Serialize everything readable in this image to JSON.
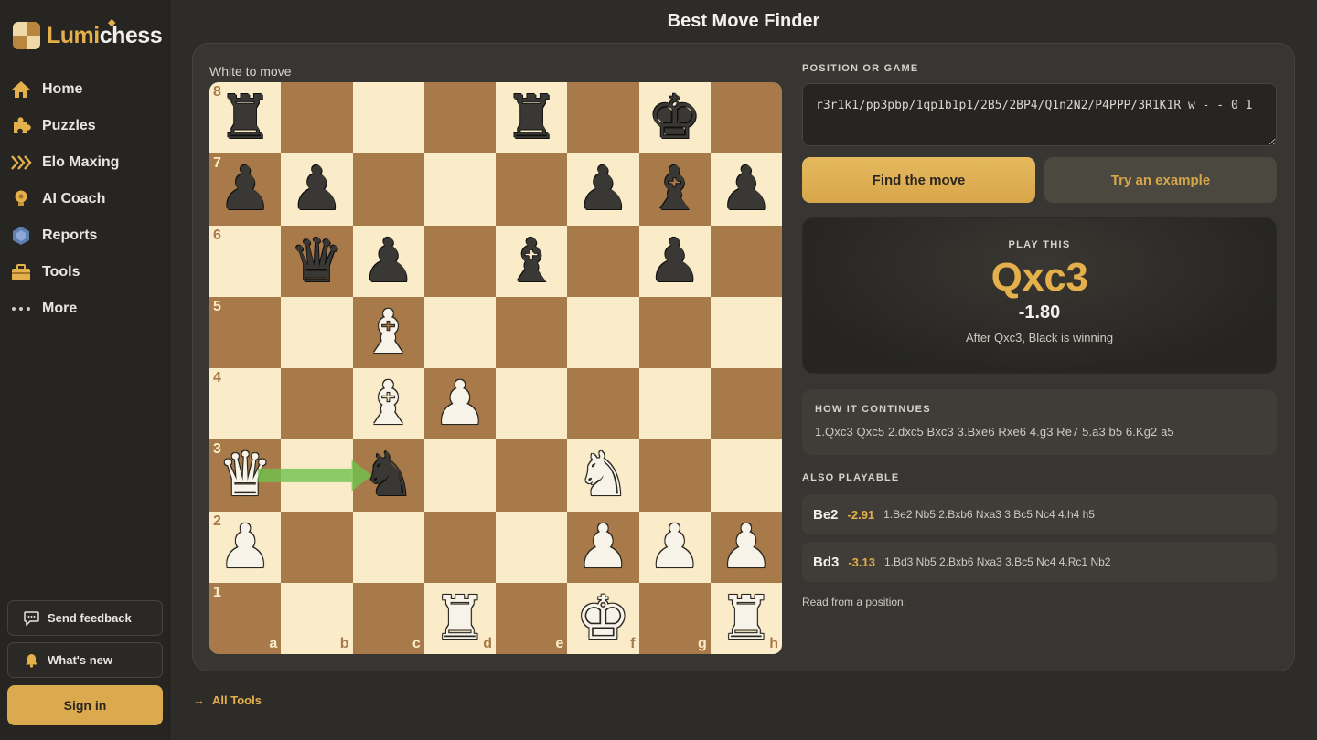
{
  "brand": {
    "part1": "Lumi",
    "part2": "chess"
  },
  "nav": [
    {
      "label": "Home",
      "icon": "home-icon"
    },
    {
      "label": "Puzzles",
      "icon": "puzzle-icon"
    },
    {
      "label": "Elo Maxing",
      "icon": "chevrons-right-icon"
    },
    {
      "label": "AI Coach",
      "icon": "lightbulb-icon"
    },
    {
      "label": "Reports",
      "icon": "hexagon-icon"
    },
    {
      "label": "Tools",
      "icon": "toolbox-icon"
    },
    {
      "label": "More",
      "icon": "more-dots-icon"
    }
  ],
  "sidebar_footer": {
    "feedback": "Send feedback",
    "whats_new": "What's new",
    "sign_in": "Sign in"
  },
  "page_title": "Best Move Finder",
  "board": {
    "to_move": "White to move",
    "ranks": [
      "8",
      "7",
      "6",
      "5",
      "4",
      "3",
      "2",
      "1"
    ],
    "files": [
      "a",
      "b",
      "c",
      "d",
      "e",
      "f",
      "g",
      "h"
    ],
    "position": [
      [
        "bR",
        "",
        "",
        "",
        "bR",
        "",
        "bK",
        ""
      ],
      [
        "bP",
        "bP",
        "",
        "",
        "",
        "bP",
        "bB",
        "bP"
      ],
      [
        "",
        "bQ",
        "bP",
        "",
        "bB",
        "",
        "bP",
        ""
      ],
      [
        "",
        "",
        "wB",
        "",
        "",
        "",
        "",
        ""
      ],
      [
        "",
        "",
        "wB",
        "wP",
        "",
        "",
        "",
        ""
      ],
      [
        "wQ",
        "",
        "bN",
        "",
        "",
        "wN",
        "",
        ""
      ],
      [
        "wP",
        "",
        "",
        "",
        "",
        "wP",
        "wP",
        "wP"
      ],
      [
        "",
        "",
        "",
        "wR",
        "",
        "wK",
        "",
        "wR"
      ]
    ],
    "arrow": {
      "from": "a3",
      "to": "c3",
      "color": "#6fc24f"
    }
  },
  "position_label": "POSITION OR GAME",
  "fen": "r3r1k1/pp3pbp/1qp1b1p1/2B5/2BP4/Q1n2N2/P4PPP/3R1K1R w - - 0 1",
  "buttons": {
    "find": "Find the move",
    "example": "Try an example"
  },
  "result": {
    "kicker": "PLAY THIS",
    "move": "Qxc3",
    "eval": "-1.80",
    "comment": "After Qxc3, Black is winning"
  },
  "continuation": {
    "label": "HOW IT CONTINUES",
    "line": "1.Qxc3 Qxc5 2.dxc5 Bxc3 3.Bxe6 Rxe6 4.g3 Re7 5.a3 b5 6.Kg2 a5"
  },
  "also_playable": {
    "label": "ALSO PLAYABLE",
    "items": [
      {
        "move": "Be2",
        "eval": "-2.91",
        "line": "1.Be2 Nb5 2.Bxb6 Nxa3 3.Bc5 Nc4 4.h4 h5"
      },
      {
        "move": "Bd3",
        "eval": "-3.13",
        "line": "1.Bd3 Nb5 2.Bxb6 Nxa3 3.Bc5 Nc4 4.Rc1 Nb2"
      }
    ]
  },
  "note": "Read from a position.",
  "all_tools": "All Tools",
  "colors": {
    "accent": "#e3b04b",
    "light_square": "#fbecc9",
    "dark_square": "#a97a49"
  }
}
